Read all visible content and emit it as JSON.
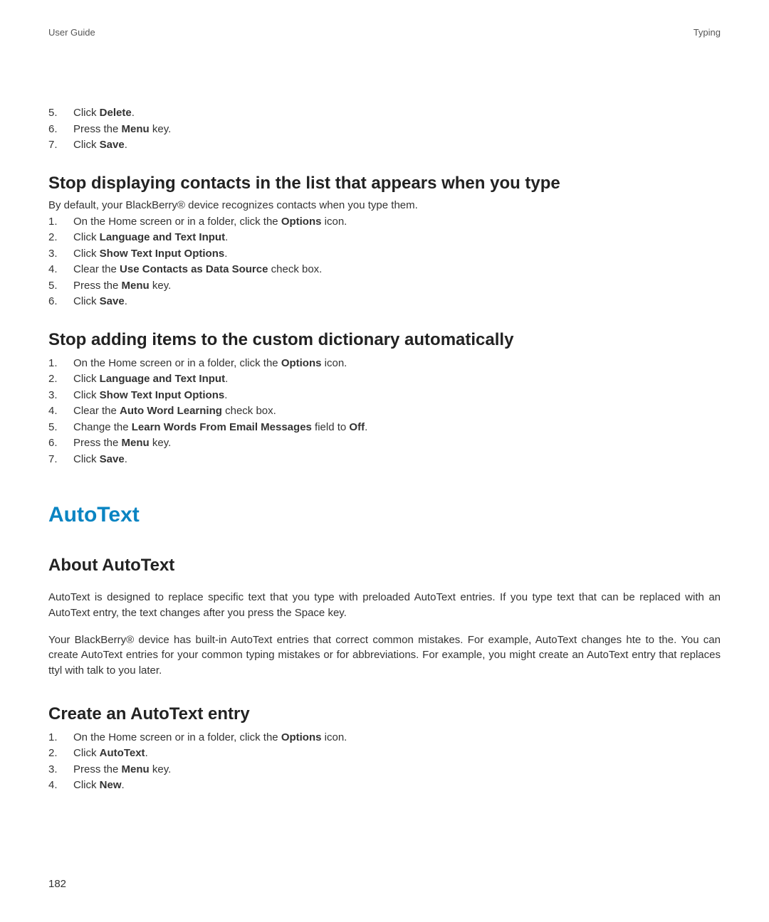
{
  "header": {
    "left": "User Guide",
    "right": "Typing"
  },
  "top_list": {
    "start": 4,
    "items": [
      {
        "prefix": "Click ",
        "bold": "Delete",
        "suffix": "."
      },
      {
        "prefix": "Press the ",
        "bold": "Menu",
        "suffix": " key."
      },
      {
        "prefix": "Click ",
        "bold": "Save",
        "suffix": "."
      }
    ]
  },
  "section1": {
    "heading": "Stop displaying contacts in the list that appears when you type",
    "intro": "By default, your BlackBerry® device recognizes contacts when you type them.",
    "items": [
      {
        "prefix": "On the Home screen or in a folder, click the ",
        "bold": "Options",
        "suffix": " icon."
      },
      {
        "prefix": "Click ",
        "bold": "Language and Text Input",
        "suffix": "."
      },
      {
        "prefix": "Click ",
        "bold": "Show Text Input Options",
        "suffix": "."
      },
      {
        "prefix": "Clear the ",
        "bold": "Use Contacts as Data Source",
        "suffix": " check box."
      },
      {
        "prefix": "Press the ",
        "bold": "Menu",
        "suffix": " key."
      },
      {
        "prefix": "Click ",
        "bold": "Save",
        "suffix": "."
      }
    ]
  },
  "section2": {
    "heading": "Stop adding items to the custom dictionary automatically",
    "items": [
      {
        "prefix": "On the Home screen or in a folder, click the ",
        "bold": "Options",
        "suffix": " icon."
      },
      {
        "prefix": "Click ",
        "bold": "Language and Text Input",
        "suffix": "."
      },
      {
        "prefix": "Click ",
        "bold": "Show Text Input Options",
        "suffix": "."
      },
      {
        "prefix": "Clear the ",
        "bold": "Auto Word Learning",
        "suffix": " check box."
      },
      {
        "prefix": "Change the ",
        "bold": "Learn Words From Email Messages",
        "suffix": " field to ",
        "bold2": "Off",
        "suffix2": "."
      },
      {
        "prefix": "Press the ",
        "bold": "Menu",
        "suffix": " key."
      },
      {
        "prefix": "Click ",
        "bold": "Save",
        "suffix": "."
      }
    ]
  },
  "autotext": {
    "main_heading": "AutoText",
    "about_heading": "About AutoText",
    "para1": "AutoText is designed to replace specific text that you type with preloaded AutoText entries. If you type text that can be replaced with an AutoText entry, the text changes after you press the Space key.",
    "para2": "Your BlackBerry® device has built-in AutoText entries that correct common mistakes. For example, AutoText changes hte to the. You can create AutoText entries for your common typing mistakes or for abbreviations. For example, you might create an AutoText entry that replaces ttyl with talk to you later.",
    "create_heading": "Create an AutoText entry",
    "create_items": [
      {
        "prefix": "On the Home screen or in a folder, click the ",
        "bold": "Options",
        "suffix": " icon."
      },
      {
        "prefix": "Click ",
        "bold": "AutoText",
        "suffix": "."
      },
      {
        "prefix": "Press the ",
        "bold": "Menu",
        "suffix": " key."
      },
      {
        "prefix": "Click ",
        "bold": "New",
        "suffix": "."
      }
    ]
  },
  "page_number": "182"
}
